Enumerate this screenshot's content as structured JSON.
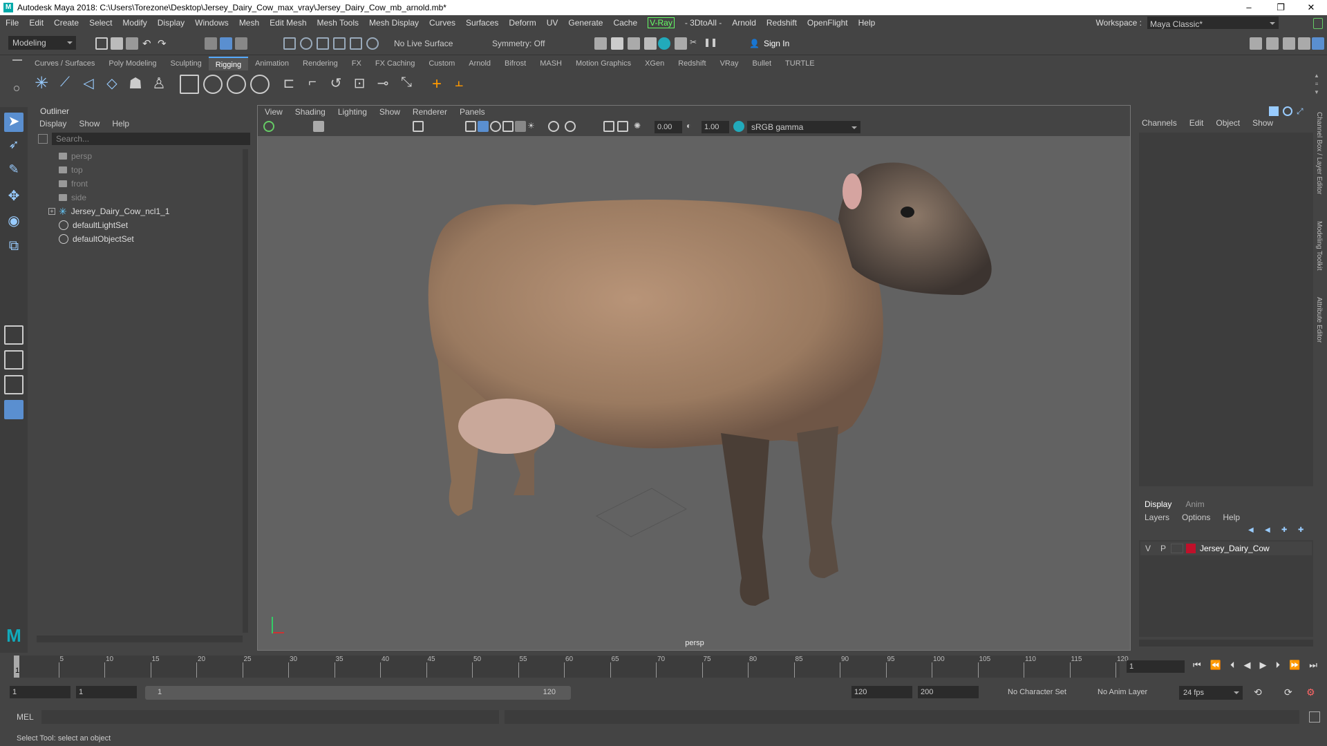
{
  "window": {
    "title": "Autodesk Maya 2018: C:\\Users\\Torezone\\Desktop\\Jersey_Dairy_Cow_max_vray\\Jersey_Dairy_Cow_mb_arnold.mb*"
  },
  "menu": [
    "File",
    "Edit",
    "Create",
    "Select",
    "Modify",
    "Display",
    "Windows",
    "Mesh",
    "Edit Mesh",
    "Mesh Tools",
    "Mesh Display",
    "Curves",
    "Surfaces",
    "Deform",
    "UV",
    "Generate",
    "Cache",
    "V-Ray",
    "- 3DtoAll -",
    "Arnold",
    "Redshift",
    "OpenFlight",
    "Help"
  ],
  "workspace": {
    "label": "Workspace :",
    "value": "Maya Classic*"
  },
  "status": {
    "mode": "Modeling",
    "live_surface": "No Live Surface",
    "symmetry": "Symmetry: Off",
    "sign_in": "Sign In"
  },
  "shelf_tabs": [
    "Curves / Surfaces",
    "Poly Modeling",
    "Sculpting",
    "Rigging",
    "Animation",
    "Rendering",
    "FX",
    "FX Caching",
    "Custom",
    "Arnold",
    "Bifrost",
    "MASH",
    "Motion Graphics",
    "XGen",
    "Redshift",
    "VRay",
    "Bullet",
    "TURTLE"
  ],
  "shelf_active": "Rigging",
  "outliner": {
    "title": "Outliner",
    "menu": [
      "Display",
      "Show",
      "Help"
    ],
    "search_placeholder": "Search...",
    "items": [
      {
        "label": "persp",
        "dim": true
      },
      {
        "label": "top",
        "dim": true
      },
      {
        "label": "front",
        "dim": true
      },
      {
        "label": "side",
        "dim": true
      },
      {
        "label": "Jersey_Dairy_Cow_ncl1_1",
        "dim": false
      },
      {
        "label": "defaultLightSet",
        "dim": false
      },
      {
        "label": "defaultObjectSet",
        "dim": false
      }
    ]
  },
  "viewport": {
    "menu": [
      "View",
      "Shading",
      "Lighting",
      "Show",
      "Renderer",
      "Panels"
    ],
    "exposure": "0.00",
    "gamma": "1.00",
    "colorspace": "sRGB gamma",
    "camera_label": "persp"
  },
  "channel_box": {
    "menu": [
      "Channels",
      "Edit",
      "Object",
      "Show"
    ]
  },
  "layer_editor": {
    "tabs": [
      "Display",
      "Anim"
    ],
    "menu": [
      "Layers",
      "Options",
      "Help"
    ],
    "layer": {
      "v": "V",
      "p": "P",
      "name": "Jersey_Dairy_Cow",
      "color": "#c0102a"
    }
  },
  "side_tabs": [
    "Channel Box / Layer Editor",
    "Modeling Toolkit",
    "Attribute Editor"
  ],
  "timeline": {
    "ticks": [
      "5",
      "10",
      "15",
      "20",
      "25",
      "30",
      "35",
      "40",
      "45",
      "50",
      "55",
      "60",
      "65",
      "70",
      "75",
      "80",
      "85",
      "90",
      "95",
      "100",
      "105",
      "110",
      "115",
      "120"
    ],
    "first": "1",
    "current_frame": "1"
  },
  "range": {
    "start": "1",
    "playback_start": "1",
    "slider_start": "1",
    "slider_end": "120",
    "playback_end": "120",
    "end": "200",
    "char_set": "No Character Set",
    "anim_layer": "No Anim Layer",
    "fps": "24 fps"
  },
  "command": {
    "label": "MEL"
  },
  "help_line": "Select Tool: select an object"
}
